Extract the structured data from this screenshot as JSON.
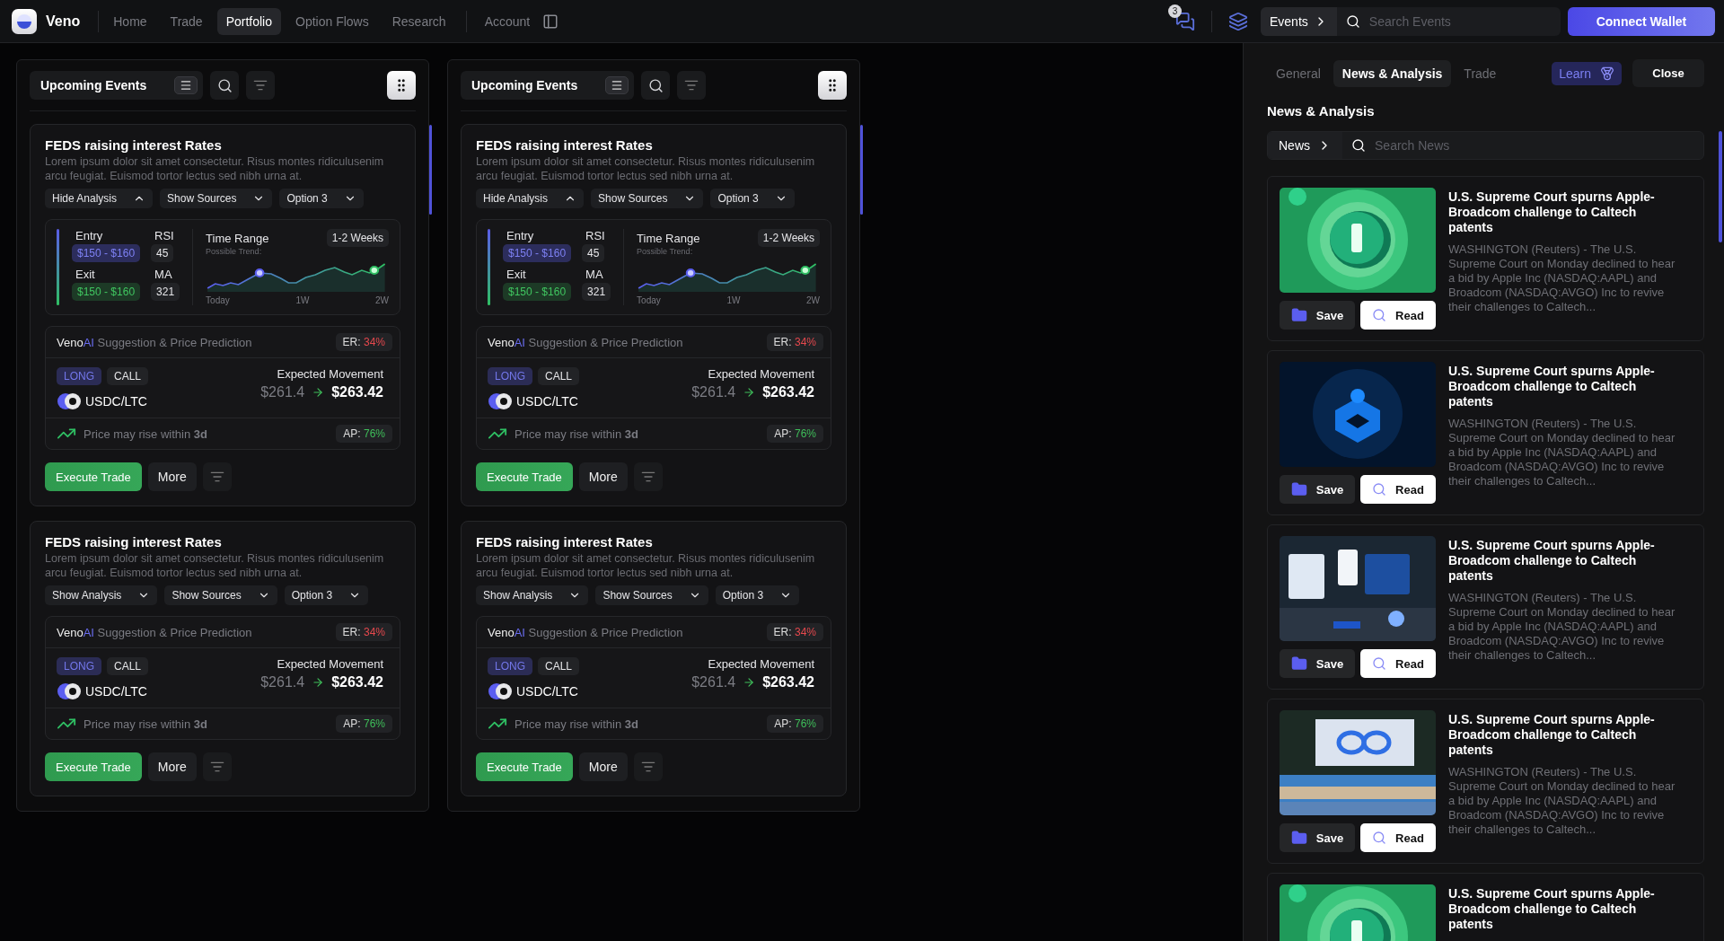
{
  "topbar": {
    "brand": "Veno",
    "nav": [
      {
        "label": "Home",
        "selected": false
      },
      {
        "label": "Trade",
        "selected": false
      },
      {
        "label": "Portfolio",
        "selected": true
      },
      {
        "label": "Option Flows",
        "selected": false
      },
      {
        "label": "Research",
        "selected": false
      }
    ],
    "account": "Account",
    "chat_badge": "3",
    "scope": "Events",
    "search": {
      "placeholder": "Search Events"
    },
    "connect": "Connect Wallet"
  },
  "columns": [
    {
      "title": "Upcoming Events",
      "cards": [
        {
          "title": "FEDS raising interest Rates",
          "description": "Lorem ipsum dolor sit amet consectetur. Risus montes ridiculusenim arcu feugiat. Euismod tortor lectus sed nibh urna at.",
          "dropdowns": [
            {
              "label": "Hide Analysis",
              "expanded": true
            },
            {
              "label": "Show Sources",
              "expanded": false
            },
            {
              "label": "Option 3",
              "expanded": false
            }
          ],
          "analysis": {
            "entry_label": "Entry",
            "entry": "$150 - $160",
            "exit_label": "Exit",
            "exit": "$150 - $160",
            "rsi_label": "RSI",
            "rsi": "45",
            "ma_label": "MA",
            "ma": "321",
            "range_label": "Time Range",
            "range": "1-2 Weeks",
            "trend_label": "Possible Trend:",
            "axis": [
              "Today",
              "1W",
              "2W"
            ]
          },
          "suggestion": {
            "brand": "Veno",
            "brand_suffix": "AI",
            "heading": "Suggestion & Price Prediction",
            "er_label": "ER:",
            "er": "34%",
            "tags": [
              {
                "label": "LONG",
                "kind": "direction"
              },
              {
                "label": "CALL",
                "kind": "plain"
              }
            ],
            "pair": "USDC/LTC",
            "expected_label": "Expected Movement",
            "from": "$261.4",
            "to": "$263.42",
            "note": "Price may rise within **3d**",
            "ap_label": "AP:",
            "ap": "76%"
          },
          "primary": "Execute Trade",
          "secondary": "More"
        },
        {
          "title": "FEDS raising interest Rates",
          "description": "Lorem ipsum dolor sit amet consectetur. Risus montes ridiculusenim arcu feugiat. Euismod tortor lectus sed nibh urna at.",
          "dropdowns": [
            {
              "label": "Show Analysis",
              "expanded": false
            },
            {
              "label": "Show Sources",
              "expanded": false
            },
            {
              "label": "Option 3",
              "expanded": false
            }
          ],
          "suggestion": {
            "brand": "Veno",
            "brand_suffix": "AI",
            "heading": "Suggestion & Price Prediction",
            "er_label": "ER:",
            "er": "34%",
            "tags": [
              {
                "label": "LONG",
                "kind": "direction"
              },
              {
                "label": "CALL",
                "kind": "plain"
              }
            ],
            "pair": "USDC/LTC",
            "expected_label": "Expected Movement",
            "from": "$261.4",
            "to": "$263.42",
            "note": "Price may rise within **3d**",
            "ap_label": "AP:",
            "ap": "76%"
          },
          "primary": "Execute Trade",
          "secondary": "More"
        }
      ]
    },
    {
      "title": "Upcoming Events",
      "cards": [
        {
          "title": "FEDS raising interest Rates",
          "description": "Lorem ipsum dolor sit amet consectetur. Risus montes ridiculusenim arcu feugiat. Euismod tortor lectus sed nibh urna at.",
          "dropdowns": [
            {
              "label": "Hide Analysis",
              "expanded": true
            },
            {
              "label": "Show Sources",
              "expanded": false
            },
            {
              "label": "Option 3",
              "expanded": false
            }
          ],
          "analysis": {
            "entry_label": "Entry",
            "entry": "$150 - $160",
            "exit_label": "Exit",
            "exit": "$150 - $160",
            "rsi_label": "RSI",
            "rsi": "45",
            "ma_label": "MA",
            "ma": "321",
            "range_label": "Time Range",
            "range": "1-2 Weeks",
            "trend_label": "Possible Trend:",
            "axis": [
              "Today",
              "1W",
              "2W"
            ]
          },
          "suggestion": {
            "brand": "Veno",
            "brand_suffix": "AI",
            "heading": "Suggestion & Price Prediction",
            "er_label": "ER:",
            "er": "34%",
            "tags": [
              {
                "label": "LONG",
                "kind": "direction"
              },
              {
                "label": "CALL",
                "kind": "plain"
              }
            ],
            "pair": "USDC/LTC",
            "expected_label": "Expected Movement",
            "from": "$261.4",
            "to": "$263.42",
            "note": "Price may rise within **3d**",
            "ap_label": "AP:",
            "ap": "76%"
          },
          "primary": "Execute Trade",
          "secondary": "More"
        },
        {
          "title": "FEDS raising interest Rates",
          "description": "Lorem ipsum dolor sit amet consectetur. Risus montes ridiculusenim arcu feugiat. Euismod tortor lectus sed nibh urna at.",
          "dropdowns": [
            {
              "label": "Show Analysis",
              "expanded": false
            },
            {
              "label": "Show Sources",
              "expanded": false
            },
            {
              "label": "Option 3",
              "expanded": false
            }
          ],
          "suggestion": {
            "brand": "Veno",
            "brand_suffix": "AI",
            "heading": "Suggestion & Price Prediction",
            "er_label": "ER:",
            "er": "34%",
            "tags": [
              {
                "label": "LONG",
                "kind": "direction"
              },
              {
                "label": "CALL",
                "kind": "plain"
              }
            ],
            "pair": "USDC/LTC",
            "expected_label": "Expected Movement",
            "from": "$261.4",
            "to": "$263.42",
            "note": "Price may rise within **3d**",
            "ap_label": "AP:",
            "ap": "76%"
          },
          "primary": "Execute Trade",
          "secondary": "More"
        }
      ]
    }
  ],
  "panel": {
    "tabs": [
      {
        "label": "General",
        "selected": false
      },
      {
        "label": "News & Analysis",
        "selected": true
      },
      {
        "label": "Trade",
        "selected": false
      }
    ],
    "learn": "Learn",
    "close": "Close",
    "heading": "News & Analysis",
    "scope": "News",
    "search": {
      "placeholder": "Search News"
    },
    "articles": [
      {
        "title": "U.S. Supreme Court spurns Apple-Broadcom challenge to Caltech patents",
        "body": "WASHINGTON (Reuters) - The U.S. Supreme Court on Monday declined to hear a bid by Apple Inc (NASDAQ:AAPL) and Broadcom (NASDAQ:AVGO) Inc to revive their challenges to Caltech...",
        "save": "Save",
        "read": "Read"
      },
      {
        "title": "U.S. Supreme Court spurns Apple-Broadcom challenge to Caltech patents",
        "body": "WASHINGTON (Reuters) - The U.S. Supreme Court on Monday declined to hear a bid by Apple Inc (NASDAQ:AAPL) and Broadcom (NASDAQ:AVGO) Inc to revive their challenges to Caltech...",
        "save": "Save",
        "read": "Read"
      },
      {
        "title": "U.S. Supreme Court spurns Apple-Broadcom challenge to Caltech patents",
        "body": "WASHINGTON (Reuters) - The U.S. Supreme Court on Monday declined to hear a bid by Apple Inc (NASDAQ:AAPL) and Broadcom (NASDAQ:AVGO) Inc to revive their challenges to Caltech...",
        "save": "Save",
        "read": "Read"
      },
      {
        "title": "U.S. Supreme Court spurns Apple-Broadcom challenge to Caltech patents",
        "body": "WASHINGTON (Reuters) - The U.S. Supreme Court on Monday declined to hear a bid by Apple Inc (NASDAQ:AAPL) and Broadcom (NASDAQ:AVGO) Inc to revive their challenges to Caltech...",
        "save": "Save",
        "read": "Read"
      },
      {
        "title": "U.S. Supreme Court spurns Apple-Broadcom challenge to Caltech patents"
      }
    ]
  }
}
